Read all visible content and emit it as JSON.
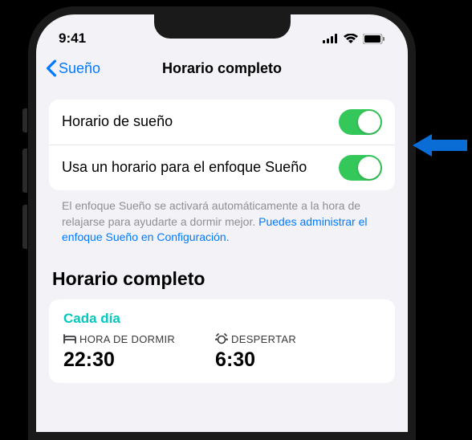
{
  "statusBar": {
    "time": "9:41"
  },
  "nav": {
    "back": "Sueño",
    "title": "Horario completo"
  },
  "toggles": {
    "sleepSchedule": {
      "label": "Horario de sueño"
    },
    "useFocus": {
      "label": "Usa un horario para el enfoque Sueño"
    }
  },
  "footer": {
    "text": "El enfoque Sueño se activará automáticamente a la hora de relajarse para ayudarte a dormir mejor. ",
    "link": "Puedes administrar el enfoque Sueño en Configuración."
  },
  "section": {
    "heading": "Horario completo"
  },
  "schedule": {
    "frequency": "Cada día",
    "bedtime": {
      "label": "HORA DE DORMIR",
      "time": "22:30"
    },
    "wake": {
      "label": "DESPERTAR",
      "time": "6:30"
    }
  }
}
